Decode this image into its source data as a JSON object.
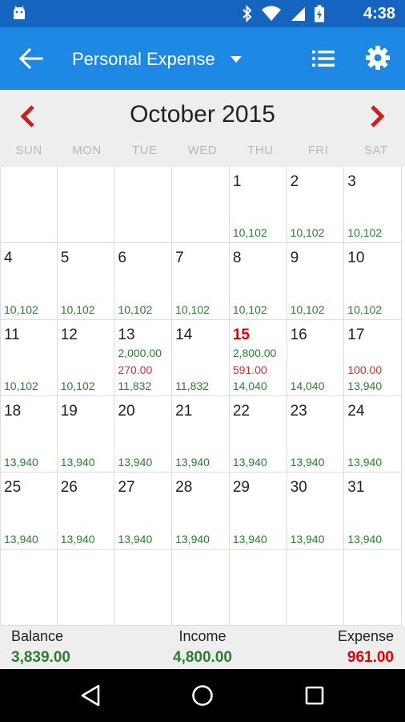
{
  "status_bar": {
    "time": "4:38"
  },
  "app_bar": {
    "title": "Personal Expense"
  },
  "calendar": {
    "month_title": "October 2015",
    "weekdays": [
      "SUN",
      "MON",
      "TUE",
      "WED",
      "THU",
      "FRI",
      "SAT"
    ],
    "cells": [
      {
        "day": "",
        "income": "",
        "expense": "",
        "balance": ""
      },
      {
        "day": "",
        "income": "",
        "expense": "",
        "balance": ""
      },
      {
        "day": "",
        "income": "",
        "expense": "",
        "balance": ""
      },
      {
        "day": "",
        "income": "",
        "expense": "",
        "balance": ""
      },
      {
        "day": "1",
        "income": "",
        "expense": "",
        "balance": "10,102"
      },
      {
        "day": "2",
        "income": "",
        "expense": "",
        "balance": "10,102"
      },
      {
        "day": "3",
        "income": "",
        "expense": "",
        "balance": "10,102"
      },
      {
        "day": "4",
        "income": "",
        "expense": "",
        "balance": "10,102"
      },
      {
        "day": "5",
        "income": "",
        "expense": "",
        "balance": "10,102"
      },
      {
        "day": "6",
        "income": "",
        "expense": "",
        "balance": "10,102"
      },
      {
        "day": "7",
        "income": "",
        "expense": "",
        "balance": "10,102"
      },
      {
        "day": "8",
        "income": "",
        "expense": "",
        "balance": "10,102"
      },
      {
        "day": "9",
        "income": "",
        "expense": "",
        "balance": "10,102"
      },
      {
        "day": "10",
        "income": "",
        "expense": "",
        "balance": "10,102"
      },
      {
        "day": "11",
        "income": "",
        "expense": "",
        "balance": "10,102"
      },
      {
        "day": "12",
        "income": "",
        "expense": "",
        "balance": "10,102"
      },
      {
        "day": "13",
        "income": "2,000.00",
        "expense": "270.00",
        "balance": "11,832"
      },
      {
        "day": "14",
        "income": "",
        "expense": "",
        "balance": "11,832"
      },
      {
        "day": "15",
        "income": "2,800.00",
        "expense": "591.00",
        "balance": "14,040",
        "today": true
      },
      {
        "day": "16",
        "income": "",
        "expense": "",
        "balance": "14,040"
      },
      {
        "day": "17",
        "income": "",
        "expense": "100.00",
        "balance": "13,940"
      },
      {
        "day": "18",
        "income": "",
        "expense": "",
        "balance": "13,940"
      },
      {
        "day": "19",
        "income": "",
        "expense": "",
        "balance": "13,940"
      },
      {
        "day": "20",
        "income": "",
        "expense": "",
        "balance": "13,940"
      },
      {
        "day": "21",
        "income": "",
        "expense": "",
        "balance": "13,940"
      },
      {
        "day": "22",
        "income": "",
        "expense": "",
        "balance": "13,940"
      },
      {
        "day": "23",
        "income": "",
        "expense": "",
        "balance": "13,940"
      },
      {
        "day": "24",
        "income": "",
        "expense": "",
        "balance": "13,940"
      },
      {
        "day": "25",
        "income": "",
        "expense": "",
        "balance": "13,940"
      },
      {
        "day": "26",
        "income": "",
        "expense": "",
        "balance": "13,940"
      },
      {
        "day": "27",
        "income": "",
        "expense": "",
        "balance": "13,940"
      },
      {
        "day": "28",
        "income": "",
        "expense": "",
        "balance": "13,940"
      },
      {
        "day": "29",
        "income": "",
        "expense": "",
        "balance": "13,940"
      },
      {
        "day": "30",
        "income": "",
        "expense": "",
        "balance": "13,940"
      },
      {
        "day": "31",
        "income": "",
        "expense": "",
        "balance": "13,940"
      },
      {
        "day": "",
        "income": "",
        "expense": "",
        "balance": ""
      },
      {
        "day": "",
        "income": "",
        "expense": "",
        "balance": ""
      },
      {
        "day": "",
        "income": "",
        "expense": "",
        "balance": ""
      },
      {
        "day": "",
        "income": "",
        "expense": "",
        "balance": ""
      },
      {
        "day": "",
        "income": "",
        "expense": "",
        "balance": ""
      },
      {
        "day": "",
        "income": "",
        "expense": "",
        "balance": ""
      },
      {
        "day": "",
        "income": "",
        "expense": "",
        "balance": ""
      }
    ]
  },
  "summary": {
    "balance_label": "Balance",
    "balance_value": "3,839.00",
    "income_label": "Income",
    "income_value": "4,800.00",
    "expense_label": "Expense",
    "expense_value": "961.00"
  },
  "colors": {
    "status_bar": "#1565c0",
    "app_bar": "#1e88e5",
    "income_green": "#2e7d32",
    "expense_red": "#d32f2f",
    "nav_arrow_red": "#cc1f1f",
    "today_red": "#e00000"
  },
  "icons": {
    "status": [
      "android-icon",
      "bluetooth-icon",
      "wifi-icon",
      "signal-icon",
      "battery-charging-icon"
    ],
    "app_bar": [
      "back-arrow-icon",
      "dropdown-arrow-icon",
      "list-icon",
      "gear-icon"
    ],
    "month_nav": [
      "chevron-left-icon",
      "chevron-right-icon"
    ],
    "system_nav": [
      "nav-back-icon",
      "nav-home-icon",
      "nav-recent-icon"
    ]
  }
}
